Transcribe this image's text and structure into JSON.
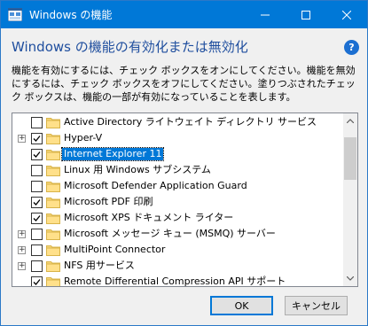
{
  "window": {
    "title": "Windows の機能",
    "heading": "Windows の機能の有効化または無効化",
    "description": "機能を有効にするには、チェック ボックスをオンにしてください。機能を無効にするには、チェック ボックスをオフにしてください。塗りつぶされたチェック ボックスは、機能の一部が有効になっていることを表します。",
    "help": "?"
  },
  "features": [
    {
      "label": "Active Directory ライトウェイト ディレクトリ サービス",
      "checked": false,
      "expandable": false,
      "selected": false
    },
    {
      "label": "Hyper-V",
      "checked": true,
      "expandable": true,
      "selected": false
    },
    {
      "label": "Internet Explorer 11",
      "checked": true,
      "expandable": false,
      "selected": true
    },
    {
      "label": "Linux 用 Windows サブシステム",
      "checked": false,
      "expandable": false,
      "selected": false
    },
    {
      "label": "Microsoft Defender Application Guard",
      "checked": false,
      "expandable": false,
      "selected": false
    },
    {
      "label": "Microsoft PDF 印刷",
      "checked": true,
      "expandable": false,
      "selected": false
    },
    {
      "label": "Microsoft XPS ドキュメント ライター",
      "checked": true,
      "expandable": false,
      "selected": false
    },
    {
      "label": "Microsoft メッセージ キュー (MSMQ) サーバー",
      "checked": false,
      "expandable": true,
      "selected": false
    },
    {
      "label": "MultiPoint Connector",
      "checked": false,
      "expandable": true,
      "selected": false
    },
    {
      "label": "NFS 用サービス",
      "checked": false,
      "expandable": true,
      "selected": false
    },
    {
      "label": "Remote Differential Compression API サポート",
      "checked": true,
      "expandable": false,
      "selected": false
    }
  ],
  "buttons": {
    "ok": "OK",
    "cancel": "キャンセル"
  },
  "colors": {
    "titlebar": "#0078d7",
    "heading": "#1f4e9e",
    "selection": "#0078d7"
  }
}
